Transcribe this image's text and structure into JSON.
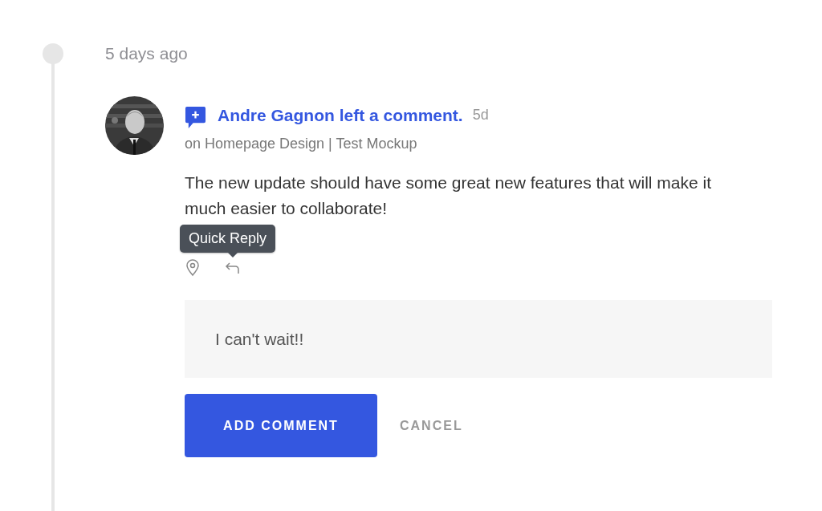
{
  "timeline": {
    "date": "5 days ago"
  },
  "activity": {
    "title": "Andre Gagnon left a comment.",
    "age": "5d",
    "context": "on Homepage Design | Test Mockup",
    "body": "The new update should have some great new features that will make it much easier to collaborate!"
  },
  "tooltip": {
    "text": "Quick Reply"
  },
  "reply": {
    "value": "I can't wait!!"
  },
  "buttons": [
    {
      "kind": "primary",
      "label": "ADD COMMENT"
    },
    {
      "kind": "secondary",
      "label": "CANCEL"
    }
  ]
}
